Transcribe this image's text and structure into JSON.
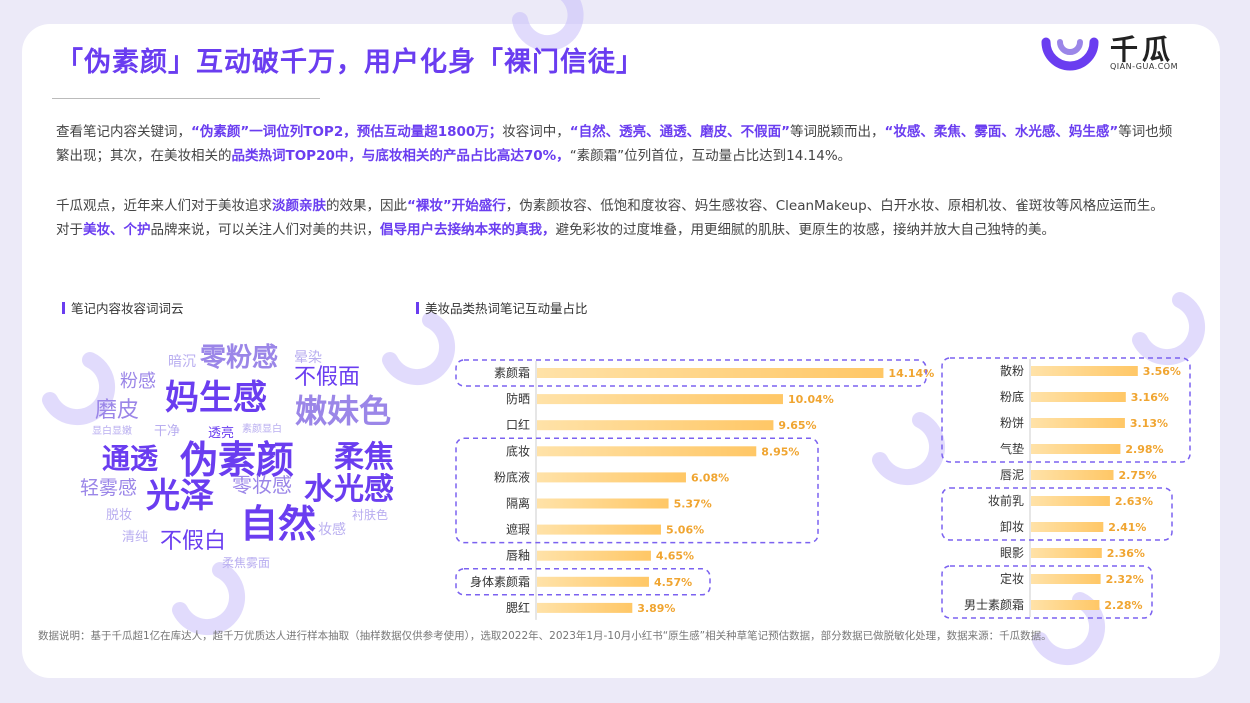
{
  "header": {
    "title": "「伪素颜」互动破千万，用户化身「裸门信徒」"
  },
  "logo": {
    "name": "千瓜",
    "sub": "QIAN-GUA.COM"
  },
  "para1": [
    {
      "t": "查看笔记内容关键词，"
    },
    {
      "t": "“伪素颜”一词位列TOP2，预估互动量超1800万；",
      "h": true
    },
    {
      "t": "妆容词中，"
    },
    {
      "t": "“自然、透亮、通透、磨皮、不假面”",
      "h": true
    },
    {
      "t": "等词脱颖而出，"
    },
    {
      "t": "“妆感、柔焦、雾面、水光感、妈生感”",
      "h": true
    },
    {
      "t": "等词也频繁出现；其次，在美妆相关的"
    },
    {
      "t": "品类热词TOP20中，与底妆相关的产品占比高达70%，",
      "h": true
    },
    {
      "t": "“素颜霜”位列首位，互动量占比达到14.14%。"
    }
  ],
  "para2": [
    {
      "t": "千瓜观点，近年来人们对于美妆追求"
    },
    {
      "t": "淡颜亲肤",
      "h": true
    },
    {
      "t": "的效果，因此"
    },
    {
      "t": "“裸妆”开始盛行",
      "h": true
    },
    {
      "t": "，伪素颜妆容、低饱和度妆容、妈生感妆容、CleanMakeup、白开水妆、原相机妆、雀斑妆等风格应运而生。对于"
    },
    {
      "t": "美妆、个护",
      "h": true
    },
    {
      "t": "品牌来说，可以关注人们对美的共识，"
    },
    {
      "t": "倡导用户去接纳本来的真我，",
      "h": true
    },
    {
      "t": "避免彩妆的过度堆叠，用更细腻的肌肤、更原生的妆感，接纳并放大自己独特的美。"
    }
  ],
  "sections": {
    "cloud_title": "笔记内容妆容词词云",
    "chart_title": "美妆品类热词笔记互动量占比"
  },
  "word_cloud": [
    {
      "text": "零粉感",
      "size": 26,
      "color": "#9b86e8"
    },
    {
      "text": "晕染",
      "size": 14,
      "color": "#b9aef0"
    },
    {
      "text": "暗沉",
      "size": 14,
      "color": "#b9aef0"
    },
    {
      "text": "粉感",
      "size": 18,
      "color": "#9b86e8"
    },
    {
      "text": "妈生感",
      "size": 34,
      "color": "#6a3df0"
    },
    {
      "text": "不假面",
      "size": 22,
      "color": "#6a3df0"
    },
    {
      "text": "磨皮",
      "size": 22,
      "color": "#9b86e8"
    },
    {
      "text": "嫩妹色",
      "size": 32,
      "color": "#9b86e8"
    },
    {
      "text": "显白显嫩",
      "size": 10,
      "color": "#b9aef0"
    },
    {
      "text": "干净",
      "size": 13,
      "color": "#b9aef0"
    },
    {
      "text": "透亮",
      "size": 13,
      "color": "#6a3df0"
    },
    {
      "text": "素颜显白",
      "size": 10,
      "color": "#b9aef0"
    },
    {
      "text": "通透",
      "size": 28,
      "color": "#6a3df0"
    },
    {
      "text": "伪素颜",
      "size": 38,
      "color": "#6a3df0"
    },
    {
      "text": "柔焦",
      "size": 30,
      "color": "#6a3df0"
    },
    {
      "text": "轻雾感",
      "size": 19,
      "color": "#9b86e8"
    },
    {
      "text": "光泽",
      "size": 34,
      "color": "#6a3df0"
    },
    {
      "text": "零妆感",
      "size": 20,
      "color": "#9b86e8"
    },
    {
      "text": "水光感",
      "size": 30,
      "color": "#6a3df0"
    },
    {
      "text": "脱妆",
      "size": 13,
      "color": "#b9aef0"
    },
    {
      "text": "自然",
      "size": 38,
      "color": "#6a3df0"
    },
    {
      "text": "衬肤色",
      "size": 12,
      "color": "#b9aef0"
    },
    {
      "text": "清纯",
      "size": 13,
      "color": "#b9aef0"
    },
    {
      "text": "不假白",
      "size": 22,
      "color": "#6a3df0"
    },
    {
      "text": "妆感",
      "size": 14,
      "color": "#b9aef0"
    },
    {
      "text": "柔焦雾面",
      "size": 12,
      "color": "#b9aef0"
    }
  ],
  "chart_data": [
    {
      "type": "bar",
      "orientation": "horizontal",
      "title": "美妆品类热词笔记互动量占比",
      "unit": "%",
      "categories": [
        "素颜霜",
        "防晒",
        "口红",
        "底妆",
        "粉底液",
        "隔离",
        "遮瑕",
        "唇釉",
        "身体素颜霜",
        "腮红"
      ],
      "values": [
        14.14,
        10.04,
        9.65,
        8.95,
        6.08,
        5.37,
        5.06,
        4.65,
        4.57,
        3.89
      ],
      "labels": [
        "14.14%",
        "10.04%",
        "9.65%",
        "8.95%",
        "6.08%",
        "5.37%",
        "5.06%",
        "4.65%",
        "4.57%",
        "3.89%"
      ],
      "highlight_groups": [
        [
          "素颜霜"
        ],
        [
          "底妆",
          "粉底液",
          "隔离",
          "遮瑕"
        ],
        [
          "身体素颜霜"
        ]
      ]
    },
    {
      "type": "bar",
      "orientation": "horizontal",
      "unit": "%",
      "categories": [
        "散粉",
        "粉底",
        "粉饼",
        "气垫",
        "唇泥",
        "妆前乳",
        "卸妆",
        "眼影",
        "定妆",
        "男士素颜霜"
      ],
      "values": [
        3.56,
        3.16,
        3.13,
        2.98,
        2.75,
        2.63,
        2.41,
        2.36,
        2.32,
        2.28
      ],
      "labels": [
        "3.56%",
        "3.16%",
        "3.13%",
        "2.98%",
        "2.75%",
        "2.63%",
        "2.41%",
        "2.36%",
        "2.32%",
        "2.28%"
      ],
      "highlight_groups": [
        [
          "散粉",
          "粉底",
          "粉饼",
          "气垫"
        ],
        [
          "妆前乳",
          "卸妆"
        ],
        [
          "定妆",
          "男士素颜霜"
        ]
      ]
    }
  ],
  "colors": {
    "accent": "#6a3df0",
    "bar": "#ffc766",
    "bar_light": "#ffe2a8",
    "label": "#f0a531",
    "dashed": "#7b62f0"
  },
  "footer": "数据说明：基于千瓜超1亿在库达人，超千万优质达人进行样本抽取（抽样数据仅供参考使用），选取2022年、2023年1月-10月小红书“原生感”相关种草笔记预估数据，部分数据已做脱敏化处理，数据来源：千瓜数据。"
}
